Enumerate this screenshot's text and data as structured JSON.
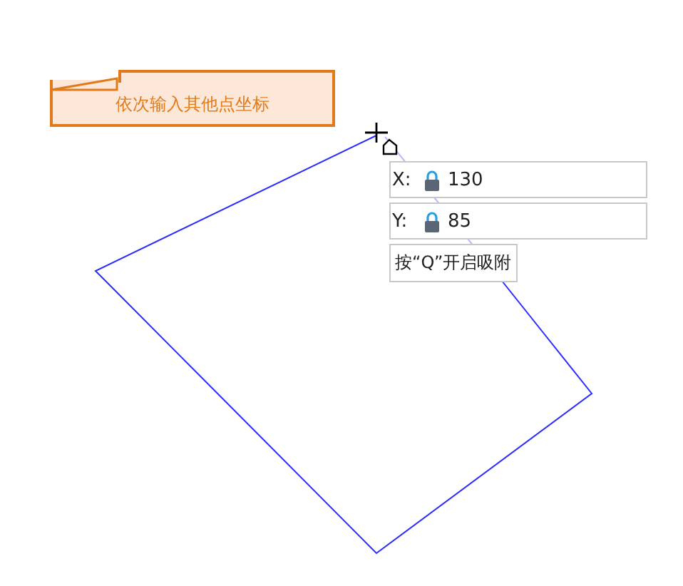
{
  "prompt": {
    "text": "依次输入其他点坐标"
  },
  "coordinate_fields": [
    {
      "label": "X:",
      "value": "130",
      "locked": true
    },
    {
      "label": "Y:",
      "value": "85",
      "locked": true
    }
  ],
  "hint": {
    "text": "按“Q”开启吸附"
  }
}
